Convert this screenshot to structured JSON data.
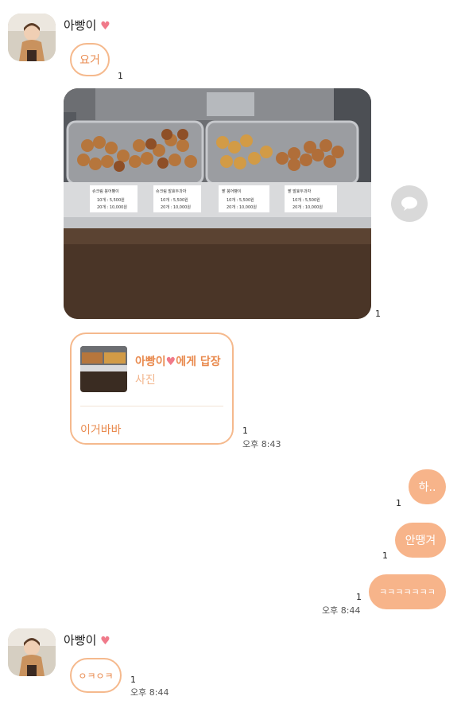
{
  "colors": {
    "accent": "#f7b48a",
    "accent_text": "#e98a4e",
    "heart": "#f07a8a"
  },
  "messages": {
    "first_sender": {
      "name": "아빵이",
      "heart": "♥"
    },
    "msg1": {
      "text": "요거",
      "count": "1"
    },
    "photo": {
      "count": "1",
      "share_icon": "speech-bubble-icon"
    },
    "reply": {
      "to": "아빵이",
      "to_heart": "♥",
      "to_suffix": "에게 답장",
      "kind": "사진",
      "text": "이거바바",
      "count": "1",
      "time": "오후 8:43"
    },
    "out1": {
      "text": "하..",
      "count": "1"
    },
    "out2": {
      "text": "안땡겨",
      "count": "1"
    },
    "out3": {
      "text": "ㅋㅋㅋㅋㅋㅋㅋ",
      "count": "1",
      "time": "오후 8:44"
    },
    "second_sender": {
      "name": "아빵이",
      "heart": "♥"
    },
    "msg_last": {
      "text": "ㅇㅋㅇㅋ",
      "count": "1",
      "time": "오후 8:44"
    }
  },
  "price_labels": [
    {
      "name": "슈크림 붕어빵이",
      "line1": "10개 : 5,500원",
      "line2": "20개 : 10,000원"
    },
    {
      "name": "슈크림 발효두과자",
      "line1": "10개 : 5,500원",
      "line2": "20개 : 10,000원"
    },
    {
      "name": "팥 붕어빵이",
      "line1": "10개 : 5,500원",
      "line2": "20개 : 10,000원"
    },
    {
      "name": "팥 발효두과자",
      "line1": "10개 : 5,500원",
      "line2": "20개 : 10,000원"
    }
  ]
}
